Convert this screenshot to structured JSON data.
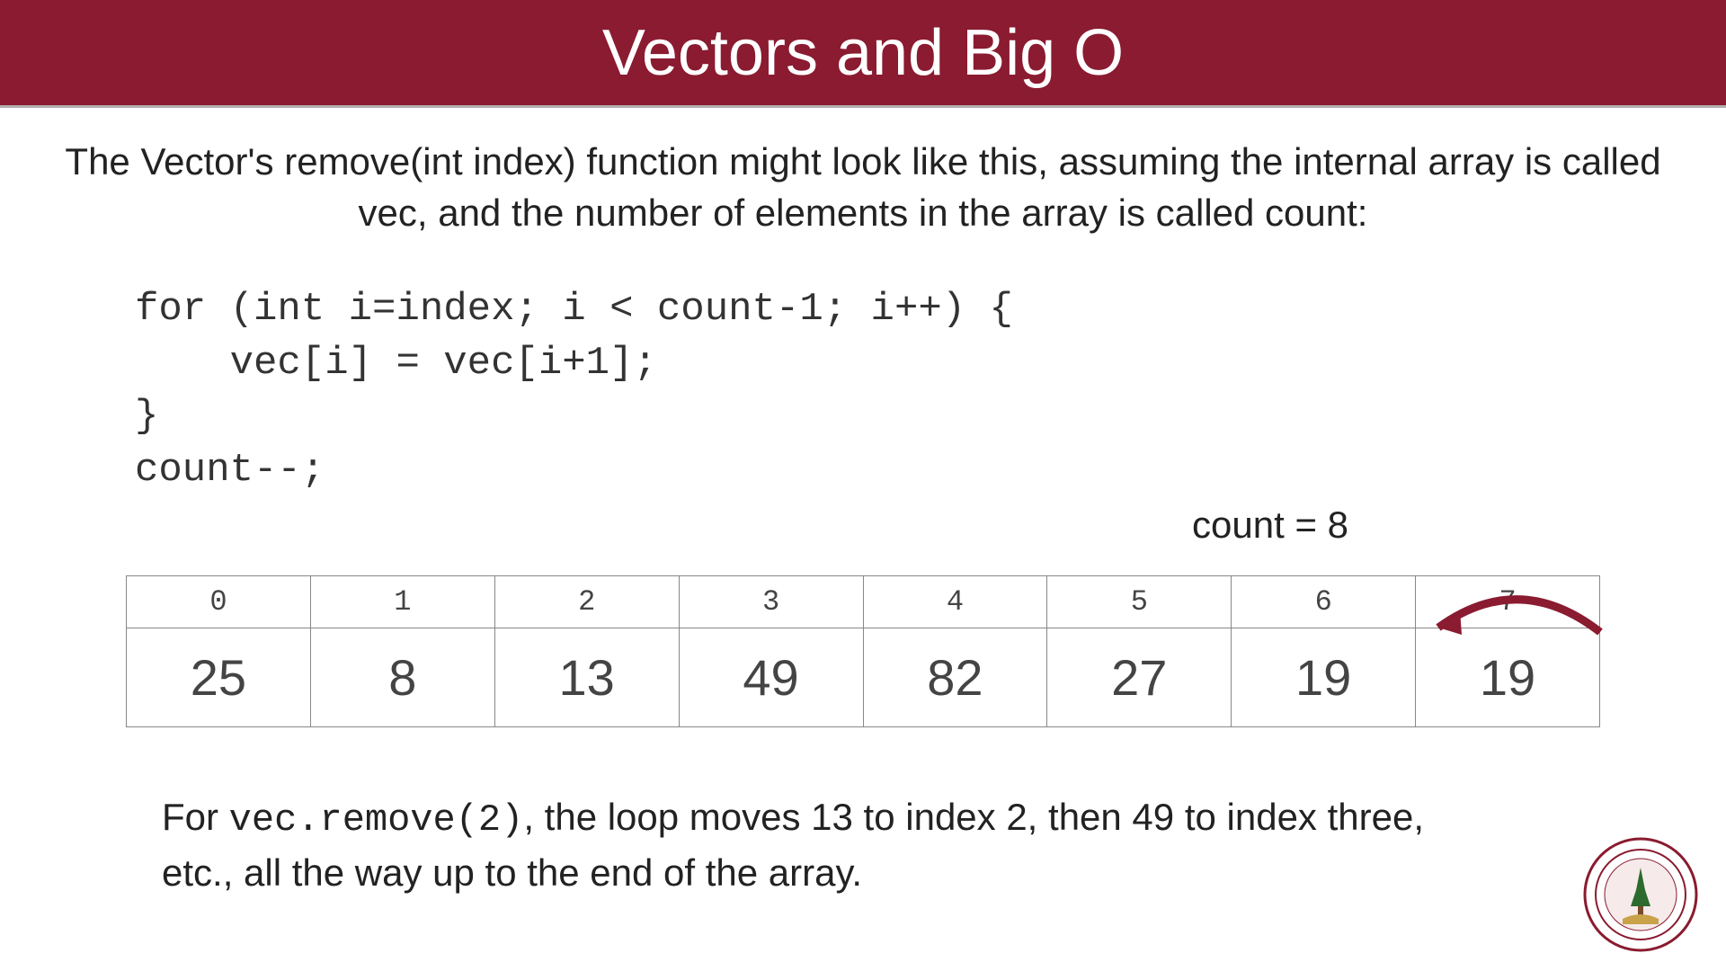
{
  "title": "Vectors and Big O",
  "intro": "The Vector's remove(int index) function might look like this, assuming the internal array is called vec, and the number of elements in the array is called count:",
  "code": "for (int i=index; i < count-1; i++) {\n    vec[i] = vec[i+1];\n}\ncount--;",
  "count_label": "count = 8",
  "array": {
    "indices": [
      "0",
      "1",
      "2",
      "3",
      "4",
      "5",
      "6",
      "7"
    ],
    "values": [
      "25",
      "8",
      "13",
      "49",
      "82",
      "27",
      "19",
      "19"
    ]
  },
  "outro_pre": "For ",
  "outro_code": "vec.remove(2)",
  "outro_post": ", the loop moves 13 to index 2, then 49 to index three, etc., all the way up to the end of the array.",
  "colors": {
    "brand": "#8a1b30"
  }
}
